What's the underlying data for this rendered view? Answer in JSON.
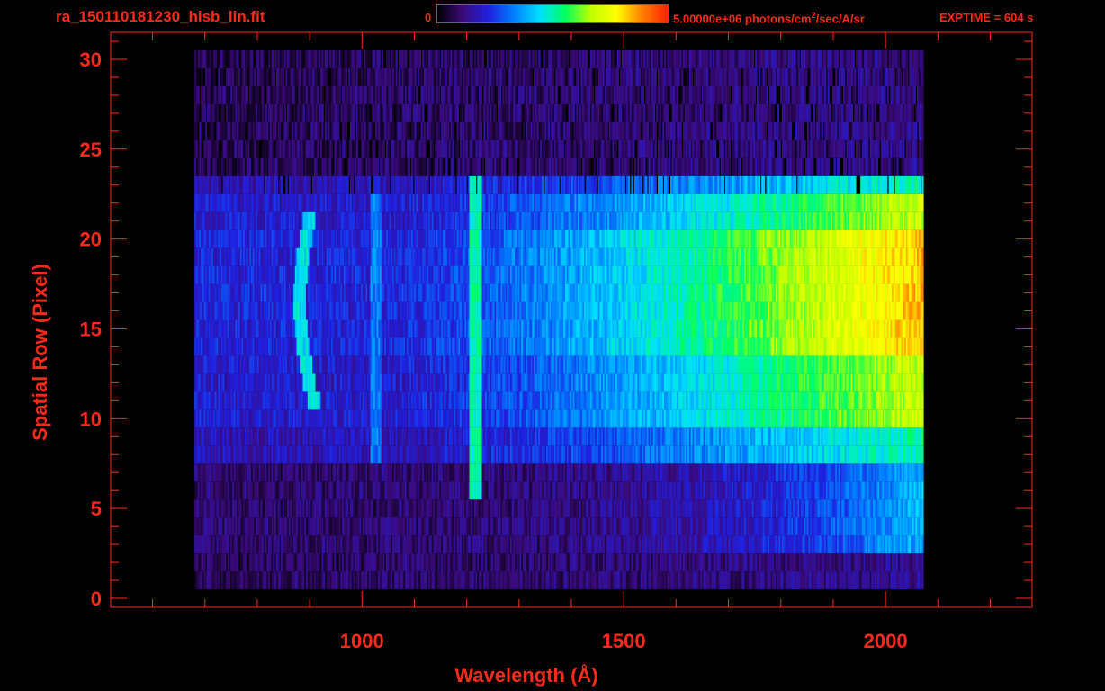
{
  "header": {
    "file_title": "ra_150110181230_hisb_lin.fit",
    "colorbar_min_label": "0",
    "colorbar_max_label_prefix": "5.00000e+06 photons/cm",
    "colorbar_max_label_exp": "2",
    "colorbar_max_label_suffix": "/sec/A/sr",
    "exptime_label": "EXPTIME = 604 s"
  },
  "colors": {
    "axis": "#ff2a1a",
    "background": "#000000",
    "colormap": [
      "#000000",
      "#3a0a7a",
      "#2020e0",
      "#0080ff",
      "#00e0ff",
      "#00ff60",
      "#c0ff00",
      "#ffff00",
      "#ff8000",
      "#ff2000"
    ]
  },
  "chart_data": {
    "type": "heatmap",
    "xlabel": "Wavelength (Å)",
    "ylabel": "Spatial Row (Pixel)",
    "xlim": [
      520,
      2280
    ],
    "ylim": [
      -0.5,
      31.5
    ],
    "x_ticks": [
      1000,
      1500,
      2000
    ],
    "y_ticks": [
      0,
      5,
      10,
      15,
      20,
      25,
      30
    ],
    "x_minor_step": 100,
    "y_minor_step": 1,
    "data_range_x": [
      680,
      2070
    ],
    "rows": 30,
    "colorbar_range": [
      0,
      5000000
    ],
    "bright_row_range": [
      8,
      23
    ],
    "features": [
      {
        "wavelength": 1216,
        "rows": [
          6,
          23
        ],
        "level": 0.35
      },
      {
        "wavelength": 1025,
        "rows": [
          8,
          22
        ],
        "level": 0.18
      },
      {
        "wavelength": 880,
        "rows": [
          11,
          21
        ],
        "level": 0.3,
        "arc": true
      }
    ]
  }
}
